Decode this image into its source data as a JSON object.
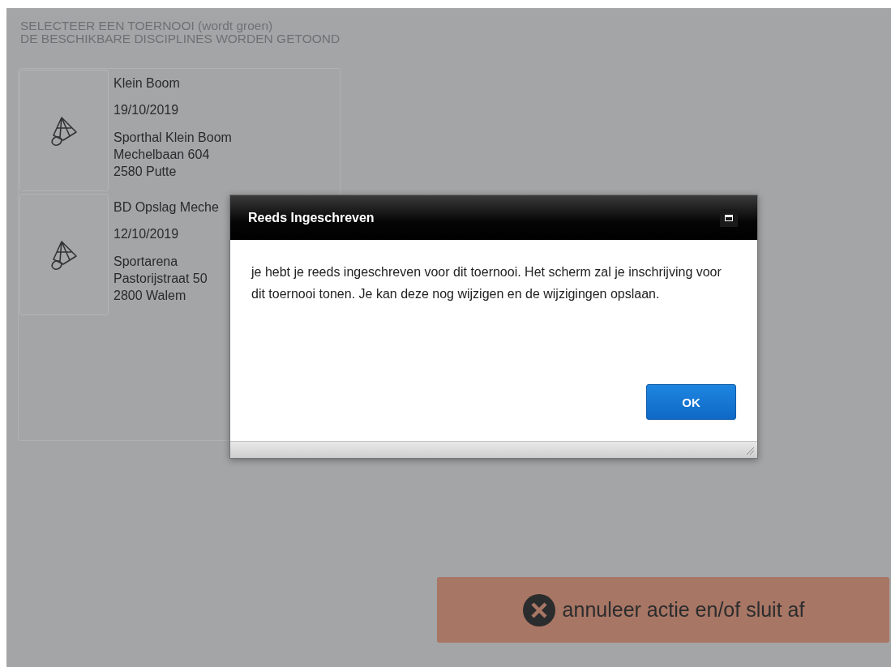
{
  "instructions": [
    "SELECTEER EEN TOERNOOI (wordt groen)",
    "DE BESCHIKBARE DISCIPLINES WORDEN GETOOND"
  ],
  "tournaments": [
    {
      "name": "Klein Boom",
      "date": "19/10/2019",
      "address": [
        "Sporthal Klein Boom",
        "Mechelbaan 604",
        "2580 Putte"
      ]
    },
    {
      "name": "BD Opslag Meche",
      "date": "12/10/2019",
      "address": [
        "Sportarena",
        "Pastorijstraat 50",
        "2800 Walem"
      ]
    }
  ],
  "dialog": {
    "title": "Reeds Ingeschreven",
    "message": "je hebt je reeds ingeschreven voor dit toernooi. Het scherm zal je inschrijving voor dit toernooi tonen. Je kan deze nog wijzigen en de wijzigingen opslaan.",
    "button": "OK"
  },
  "cancel_button": {
    "label": "annuleer actie en/of sluit af"
  }
}
